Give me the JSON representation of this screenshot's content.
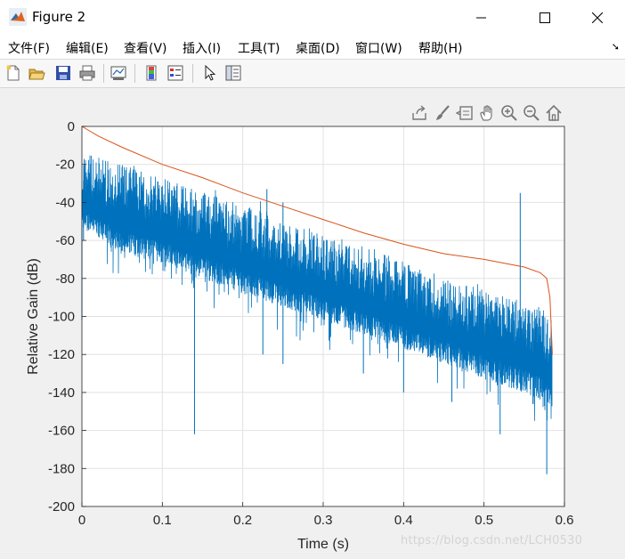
{
  "window": {
    "title": "Figure 2"
  },
  "menu": [
    "文件(F)",
    "编辑(E)",
    "查看(V)",
    "插入(I)",
    "工具(T)",
    "桌面(D)",
    "窗口(W)",
    "帮助(H)"
  ],
  "toolbar_icons": [
    "new-figure-icon",
    "open-file-icon",
    "save-icon",
    "print-icon",
    "link-plot-icon",
    "colorbar-icon",
    "legend-icon",
    "edit-plot-icon",
    "property-inspector-icon"
  ],
  "axes_toolbar_icons": [
    "export-icon",
    "brush-icon",
    "data-tips-icon",
    "pan-icon",
    "zoom-in-icon",
    "zoom-out-icon",
    "home-icon"
  ],
  "watermark": "https://blog.csdn.net/LCH0530",
  "chart_data": {
    "type": "line",
    "title": "",
    "xlabel": "Time (s)",
    "ylabel": "Relative Gain (dB)",
    "xlim": [
      0,
      0.6
    ],
    "ylim": [
      -200,
      0
    ],
    "xticks": [
      0,
      0.1,
      0.2,
      0.3,
      0.4,
      0.5,
      0.6
    ],
    "xtick_labels": [
      "0",
      "0.1",
      "0.2",
      "0.3",
      "0.4",
      "0.5",
      "0.6"
    ],
    "yticks": [
      0,
      -20,
      -40,
      -60,
      -80,
      -100,
      -120,
      -140,
      -160,
      -180,
      -200
    ],
    "ytick_labels": [
      "0",
      "-20",
      "-40",
      "-60",
      "-80",
      "-100",
      "-120",
      "-140",
      "-160",
      "-180",
      "-200"
    ],
    "grid": true,
    "legend": "none",
    "series": [
      {
        "color": "#0072bd",
        "style": "dense noisy impulse response envelope",
        "x": [
          0.0,
          0.003,
          0.05,
          0.1,
          0.15,
          0.2,
          0.25,
          0.3,
          0.35,
          0.4,
          0.45,
          0.5,
          0.55,
          0.575,
          0.585
        ],
        "upper": [
          -22,
          -14,
          -20,
          -27,
          -34,
          -41,
          -49,
          -56,
          -63,
          -71,
          -78,
          -85,
          -92,
          -97,
          -100
        ],
        "lower": [
          -55,
          -55,
          -67,
          -72,
          -80,
          -88,
          -95,
          -102,
          -110,
          -117,
          -125,
          -133,
          -140,
          -145,
          -150
        ],
        "spikes": [
          [
            0.0,
            -102
          ],
          [
            0.002,
            -60
          ],
          [
            0.14,
            -162
          ],
          [
            0.225,
            -120
          ],
          [
            0.25,
            -125
          ],
          [
            0.35,
            -130
          ],
          [
            0.4,
            -140
          ],
          [
            0.46,
            -145
          ],
          [
            0.52,
            -162
          ],
          [
            0.578,
            -183
          ],
          [
            0.545,
            -35
          ],
          [
            0.23,
            -33
          ],
          [
            0.25,
            -40
          ]
        ]
      },
      {
        "color": "#d95319",
        "style": "backward integrated energy decay curve",
        "x": [
          0.0,
          0.02,
          0.05,
          0.1,
          0.15,
          0.2,
          0.25,
          0.3,
          0.35,
          0.4,
          0.45,
          0.5,
          0.55,
          0.57,
          0.578,
          0.582,
          0.585
        ],
        "y": [
          0,
          -5,
          -11,
          -20,
          -27,
          -35,
          -42,
          -49,
          -56,
          -62,
          -67,
          -70,
          -74,
          -77,
          -80,
          -90,
          -120
        ]
      }
    ]
  }
}
